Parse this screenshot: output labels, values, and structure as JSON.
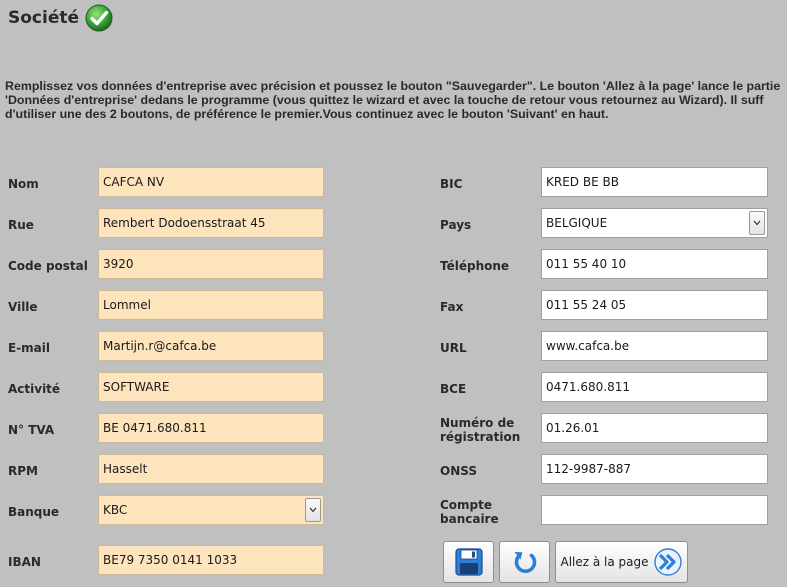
{
  "page": {
    "title": "Société",
    "intro": [
      "Remplissez vos données d'entreprise avec précision et poussez le bouton \"Sauvegarder\". Le bouton 'Allez à la page' lance le partie",
      "'Données d'entreprise' dedans le programme (vous quittez le wizard et avec la touche de retour vous retournez au Wizard). Il suff",
      "d'utiliser une des 2 boutons, de préférence le premier.Vous continuez avec le bouton 'Suivant' en haut."
    ]
  },
  "left_fields": [
    {
      "label": "Nom",
      "value": "CAFCA NV"
    },
    {
      "label": "Rue",
      "value": "Rembert Dodoensstraat 45"
    },
    {
      "label": "Code postal",
      "value": "3920"
    },
    {
      "label": "Ville",
      "value": "Lommel"
    },
    {
      "label": "E-mail",
      "value": "Martijn.r@cafca.be"
    },
    {
      "label": "Activité",
      "value": "SOFTWARE"
    },
    {
      "label": "N° TVA",
      "value": "BE 0471.680.811"
    },
    {
      "label": "RPM",
      "value": "Hasselt"
    },
    {
      "label": "Banque",
      "value": "KBC"
    },
    {
      "label": "IBAN",
      "value": "BE79 7350 0141 1033"
    }
  ],
  "right_fields": [
    {
      "label": "BIC",
      "value": "KRED BE BB"
    },
    {
      "label": "Pays",
      "value": "BELGIQUE"
    },
    {
      "label": "Téléphone",
      "value": "011 55 40 10"
    },
    {
      "label": "Fax",
      "value": "011 55 24 05"
    },
    {
      "label": "URL",
      "value": "www.cafca.be"
    },
    {
      "label": "BCE",
      "value": "0471.680.811"
    },
    {
      "label": "Numéro de régistration",
      "label_lines": [
        "Numéro de",
        "régistration"
      ],
      "value": "01.26.01"
    },
    {
      "label": "ONSS",
      "value": "112-9987-887"
    },
    {
      "label": "Compte bancaire",
      "label_lines": [
        "Compte",
        "bancaire"
      ],
      "value": ""
    }
  ],
  "buttons": {
    "goto_label": "Allez à la page"
  },
  "icons": {
    "title": "check-circle-icon",
    "save": "floppy-disk-icon",
    "refresh": "refresh-icon",
    "goto": "double-chevron-right-icon",
    "dropdown": "chevron-down-icon"
  },
  "colors": {
    "background": "#c0c0c0",
    "left_field_bg": "#fde4bd",
    "right_field_bg": "#ffffff",
    "accent_blue": "#2f7fd6",
    "check_green": "#3aa83a"
  }
}
